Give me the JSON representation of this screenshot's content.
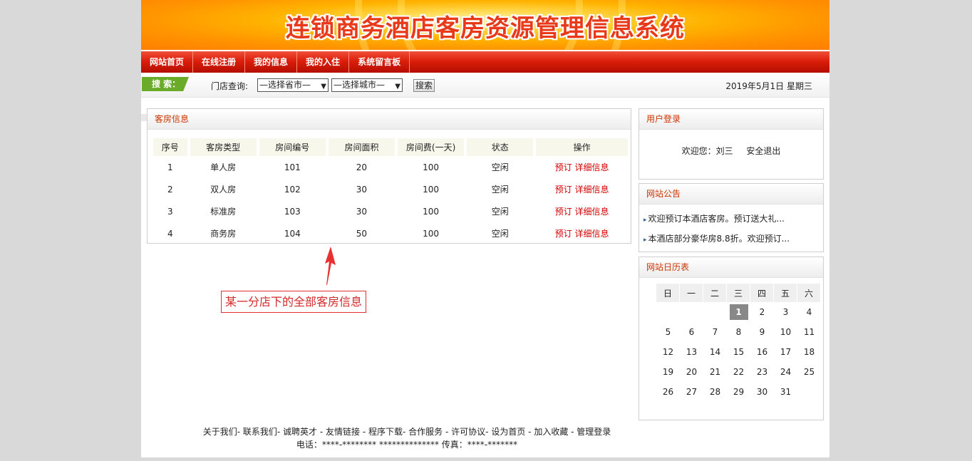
{
  "banner": {
    "title": "连锁商务酒店客房资源管理信息系统"
  },
  "nav": {
    "items": [
      "网站首页",
      "在线注册",
      "我的信息",
      "我的入住",
      "系统留言板"
    ]
  },
  "search": {
    "tag": "搜 索：",
    "store_label": "门店查询:",
    "province_select": "—选择省市—",
    "city_select": "—选择城市—",
    "button": "搜索",
    "date": "2019年5月1日 星期三"
  },
  "rooms": {
    "title": "客房信息",
    "headers": [
      "序号",
      "客房类型",
      "房间编号",
      "房间面积",
      "房间费(一天)",
      "状态",
      "操作"
    ],
    "rows": [
      {
        "no": "1",
        "type": "单人房",
        "code": "101",
        "area": "20",
        "fee": "100",
        "status": "空闲"
      },
      {
        "no": "2",
        "type": "双人房",
        "code": "102",
        "area": "30",
        "fee": "100",
        "status": "空闲"
      },
      {
        "no": "3",
        "type": "标准房",
        "code": "103",
        "area": "30",
        "fee": "100",
        "status": "空闲"
      },
      {
        "no": "4",
        "type": "商务房",
        "code": "104",
        "area": "50",
        "fee": "100",
        "status": "空闲"
      }
    ],
    "book_label": "预订",
    "detail_label": "详细信息"
  },
  "annotation": {
    "text": "某一分店下的全部客房信息"
  },
  "login": {
    "title": "用户登录",
    "welcome": "欢迎您：刘三",
    "logout": "安全退出"
  },
  "notice": {
    "title": "网站公告",
    "items": [
      "欢迎预订本酒店客房。预订送大礼...",
      "本酒店部分豪华房8.8折。欢迎预订..."
    ]
  },
  "calendar": {
    "title": "网站日历表",
    "weekdays": [
      "日",
      "一",
      "二",
      "三",
      "四",
      "五",
      "六"
    ],
    "weeks": [
      [
        "",
        "",
        "",
        "1",
        "2",
        "3",
        "4"
      ],
      [
        "5",
        "6",
        "7",
        "8",
        "9",
        "10",
        "11"
      ],
      [
        "12",
        "13",
        "14",
        "15",
        "16",
        "17",
        "18"
      ],
      [
        "19",
        "20",
        "21",
        "22",
        "23",
        "24",
        "25"
      ],
      [
        "26",
        "27",
        "28",
        "29",
        "30",
        "31",
        ""
      ]
    ],
    "today": "1"
  },
  "footer": {
    "links": [
      "关于我们",
      "联系我们",
      "诚聘英才",
      "友情链接",
      "程序下载",
      "合作服务",
      "许可协议",
      "设为首页",
      "加入收藏",
      "管理登录"
    ],
    "separators": [
      "- ",
      "- ",
      " - ",
      " - ",
      "- ",
      " - ",
      "- ",
      " - ",
      " - "
    ],
    "contact": "电话：****-******** ************** 传真：****-*******"
  },
  "colors": {
    "accent": "#dc1f0b",
    "link_red": "#d40000",
    "search_green": "#6aab2a",
    "panel_title": "#cc3300"
  }
}
